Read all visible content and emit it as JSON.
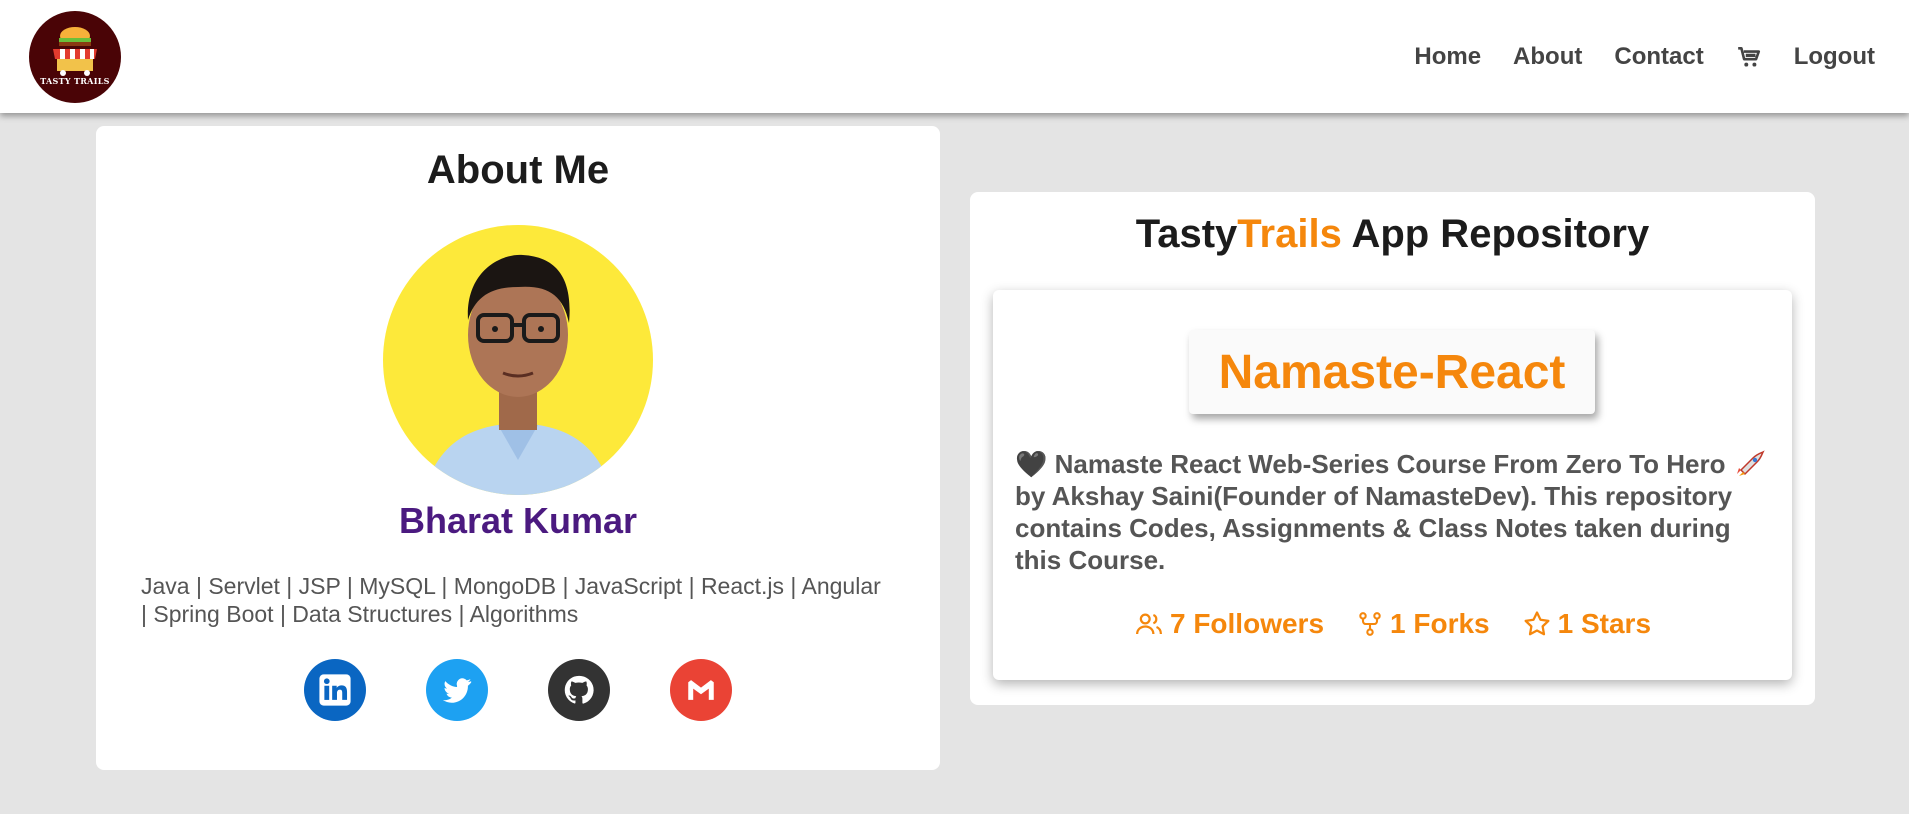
{
  "header": {
    "logo_text": "TASTY TRAILS",
    "nav": [
      {
        "label": "Home"
      },
      {
        "label": "About"
      },
      {
        "label": "Contact"
      },
      {
        "label": "Logout"
      }
    ],
    "cart_icon": "cart-icon"
  },
  "about": {
    "title": "About Me",
    "name": "Bharat Kumar",
    "skills": "Java | Servlet | JSP | MySQL | MongoDB | JavaScript | React.js | Angular | Spring Boot | Data Structures | Algorithms",
    "socials": [
      {
        "icon": "linkedin-icon",
        "color": "#0a66c2"
      },
      {
        "icon": "twitter-icon",
        "color": "#1da1f2"
      },
      {
        "icon": "github-icon",
        "color": "#333333"
      },
      {
        "icon": "gmail-icon",
        "color": "#ea4335"
      }
    ]
  },
  "repo": {
    "title_part1": "Tasty",
    "title_part2": "Trails",
    "title_part3": " App Repository",
    "name": "Namaste-React",
    "desc_heart": "🖤",
    "desc_line1": " Namaste React Web-Series Course From Zero To Hero ",
    "desc_line2": " by Akshay Saini(Founder of NamasteDev). This repository contains Codes, Assignments & Class Notes taken during this Course.",
    "followers": "7 Followers",
    "forks": "1 Forks",
    "stars": "1 Stars"
  },
  "colors": {
    "accent": "#f5870c",
    "name": "#4b1a80",
    "background": "#e4e4e4"
  }
}
